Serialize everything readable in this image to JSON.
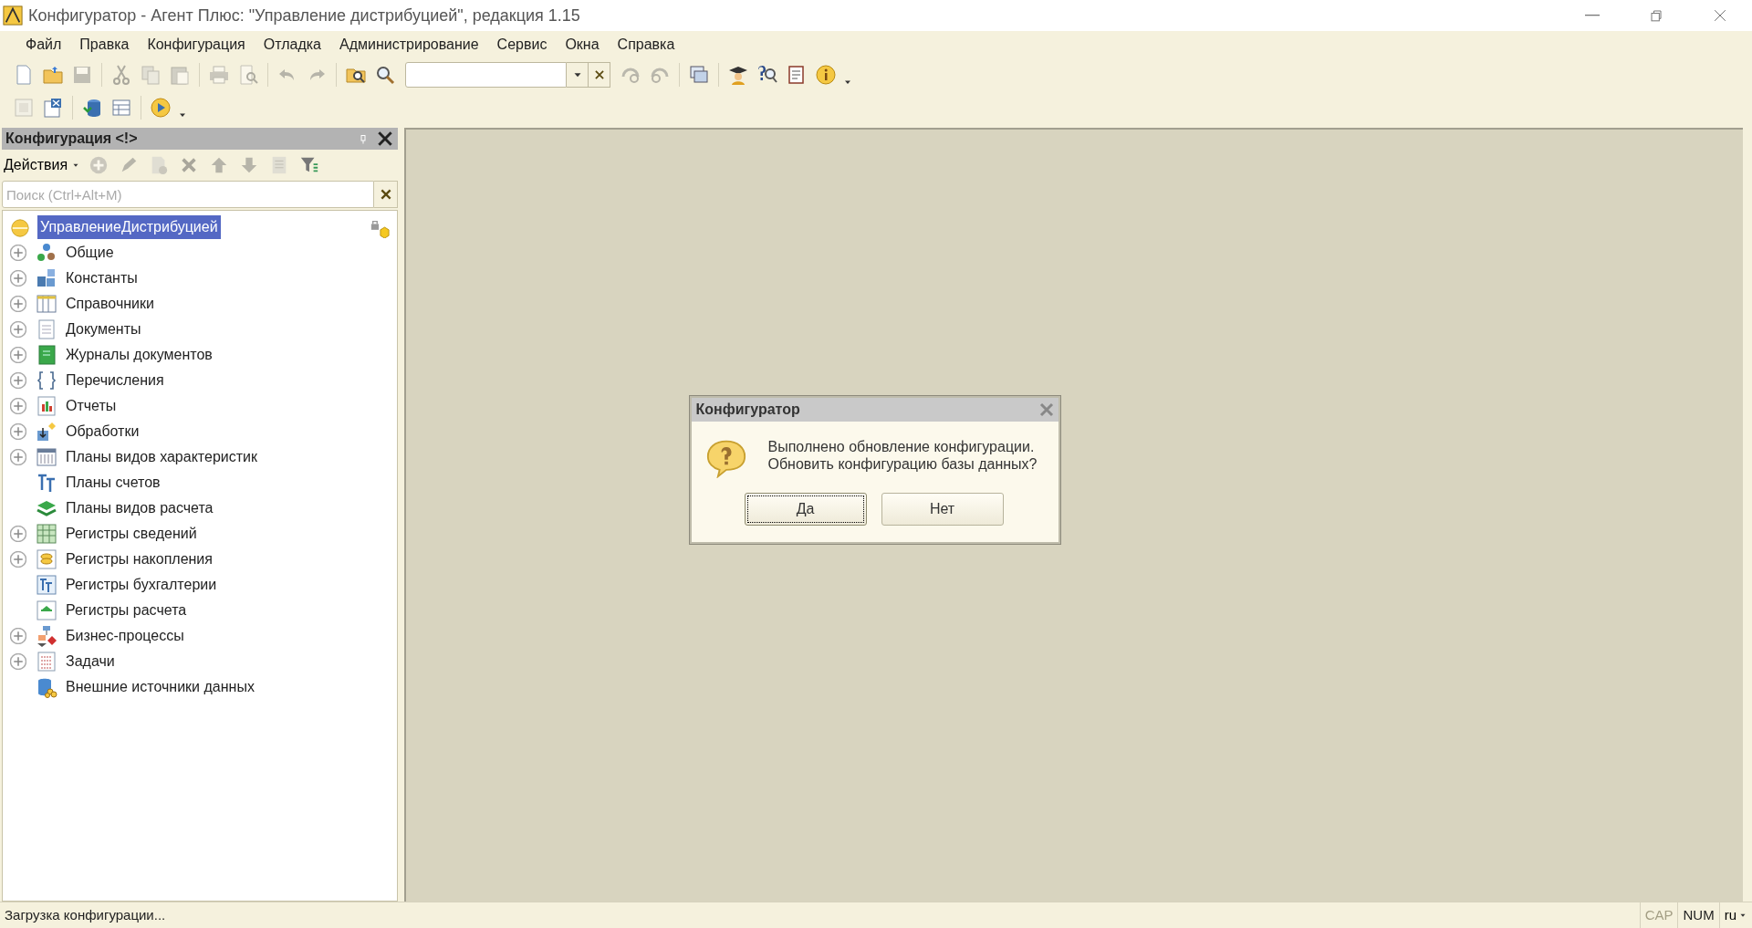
{
  "window": {
    "title": "Конфигуратор - Агент Плюс: \"Управление дистрибуцией\", редакция 1.15"
  },
  "menu": [
    "Файл",
    "Правка",
    "Конфигурация",
    "Отладка",
    "Администрирование",
    "Сервис",
    "Окна",
    "Справка"
  ],
  "toolbar_rows": [
    [
      {
        "disabled": false
      },
      {
        "disabled": false
      },
      {
        "disabled": true
      },
      {
        "disabled": true
      },
      {
        "disabled": true
      },
      {
        "disabled": true
      },
      {
        "disabled": true
      },
      {
        "disabled": true
      },
      {
        "disabled": true
      },
      {
        "disabled": true
      },
      {
        "disabled": false
      },
      {
        "disabled": false
      },
      {
        "disabled": true
      },
      {
        "disabled": true
      },
      {
        "disabled": false
      },
      {
        "disabled": false
      },
      {
        "disabled": false
      },
      {
        "disabled": false
      },
      {
        "disabled": false
      }
    ],
    [
      {
        "disabled": true
      },
      {
        "disabled": false
      },
      {
        "disabled": false
      },
      {
        "disabled": false
      },
      {
        "disabled": false
      }
    ]
  ],
  "panel": {
    "title": "Конфигурация <!>",
    "actions_label": "Действия",
    "action_buttons": [
      {
        "disabled": true
      },
      {
        "disabled": true
      },
      {
        "disabled": true
      },
      {
        "disabled": true
      },
      {
        "disabled": true
      },
      {
        "disabled": true
      },
      {
        "disabled": true
      },
      {
        "disabled": false
      }
    ],
    "search": {
      "placeholder": "Поиск (Ctrl+Alt+M)"
    },
    "tree": [
      {
        "label": "УправлениеДистрибуцией",
        "selected": true,
        "children": [
          {
            "label": "Общие",
            "selected": false,
            "expandable": true
          },
          {
            "label": "Константы",
            "selected": false,
            "expandable": true
          },
          {
            "label": "Справочники",
            "selected": false,
            "expandable": true
          },
          {
            "label": "Документы",
            "selected": false,
            "expandable": true
          },
          {
            "label": "Журналы документов",
            "selected": false,
            "expandable": true
          },
          {
            "label": "Перечисления",
            "selected": false,
            "expandable": true
          },
          {
            "label": "Отчеты",
            "selected": false,
            "expandable": true
          },
          {
            "label": "Обработки",
            "selected": false,
            "expandable": true
          },
          {
            "label": "Планы видов характеристик",
            "selected": false,
            "expandable": true
          },
          {
            "label": "Планы счетов",
            "selected": false,
            "expandable": false
          },
          {
            "label": "Планы видов расчета",
            "selected": false,
            "expandable": false
          },
          {
            "label": "Регистры сведений",
            "selected": false,
            "expandable": true
          },
          {
            "label": "Регистры накопления",
            "selected": false,
            "expandable": true
          },
          {
            "label": "Регистры бухгалтерии",
            "selected": false,
            "expandable": false
          },
          {
            "label": "Регистры расчета",
            "selected": false,
            "expandable": false
          },
          {
            "label": "Бизнес-процессы",
            "selected": false,
            "expandable": true
          },
          {
            "label": "Задачи",
            "selected": false,
            "expandable": true
          },
          {
            "label": "Внешние источники данных",
            "selected": false,
            "expandable": false
          }
        ]
      }
    ]
  },
  "dialog": {
    "title": "Конфигуратор",
    "message": [
      "Выполнено обновление конфигурации.",
      "Обновить конфигурацию базы данных?"
    ],
    "buttons": [
      {
        "label": "Да",
        "focused": true
      },
      {
        "label": "Нет",
        "focused": false
      }
    ]
  },
  "status_bar": {
    "text": "Загрузка конфигурации...",
    "indicators": [
      {
        "label": "CAP",
        "on": false
      },
      {
        "label": "NUM",
        "on": true
      }
    ],
    "language": "ru"
  }
}
